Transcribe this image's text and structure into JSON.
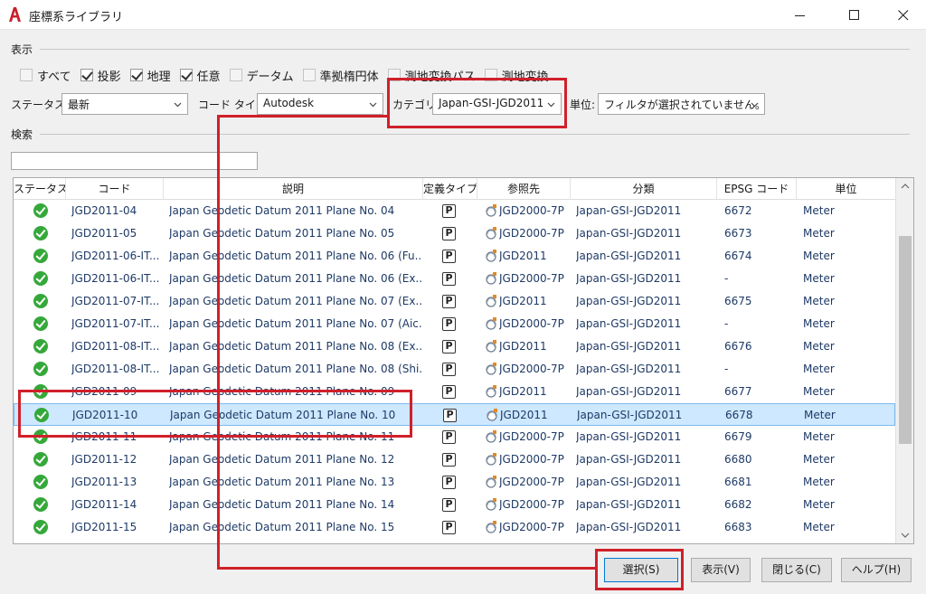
{
  "window": {
    "title": "座標系ライブラリ",
    "app_icon": "autocad-a-icon",
    "controls": [
      "minimize-icon",
      "maximize-icon",
      "close-icon"
    ]
  },
  "display_group": {
    "label": "表示",
    "checkboxes": [
      {
        "label": "すべて",
        "checked": false,
        "enabled": false
      },
      {
        "label": "投影",
        "checked": true,
        "enabled": true
      },
      {
        "label": "地理",
        "checked": true,
        "enabled": true
      },
      {
        "label": "任意",
        "checked": true,
        "enabled": true
      },
      {
        "label": "データム",
        "checked": false,
        "enabled": false
      },
      {
        "label": "準拠楕円体",
        "checked": false,
        "enabled": false
      },
      {
        "label": "測地変換パス",
        "checked": false,
        "enabled": false
      },
      {
        "label": "測地変換",
        "checked": false,
        "enabled": false
      }
    ]
  },
  "filters": {
    "status_label": "ステータス:",
    "status_value": "最新",
    "codetype_label": "コード タイプ:",
    "codetype_value": "Autodesk",
    "category_label": "カテゴリ:",
    "category_value": "Japan-GSI-JGD2011",
    "unit_label": "単位:",
    "unit_value": "フィルタが選択されていません。"
  },
  "search_group": {
    "label": "検索",
    "value": ""
  },
  "table": {
    "columns": [
      "ステータス",
      "コード",
      "説明",
      "定義タイプ",
      "参照先",
      "分類",
      "EPSG コード",
      "単位"
    ],
    "rows": [
      {
        "code": "JGD2011-04",
        "desc": "Japan Geodetic Datum 2011 Plane No. 04",
        "type": "P",
        "ref": "JGD2000-7P",
        "cls": "Japan-GSI-JGD2011",
        "epsg": "6672",
        "unit": "Meter"
      },
      {
        "code": "JGD2011-05",
        "desc": "Japan Geodetic Datum 2011 Plane No. 05",
        "type": "P",
        "ref": "JGD2000-7P",
        "cls": "Japan-GSI-JGD2011",
        "epsg": "6673",
        "unit": "Meter"
      },
      {
        "code": "JGD2011-06-IT...",
        "desc": "Japan Geodetic Datum 2011 Plane No. 06 (Fu...",
        "type": "P",
        "ref": "JGD2011",
        "cls": "Japan-GSI-JGD2011",
        "epsg": "6674",
        "unit": "Meter"
      },
      {
        "code": "JGD2011-06-IT...",
        "desc": "Japan Geodetic Datum 2011 Plane No. 06 (Ex...",
        "type": "P",
        "ref": "JGD2000-7P",
        "cls": "Japan-GSI-JGD2011",
        "epsg": "-",
        "unit": "Meter"
      },
      {
        "code": "JGD2011-07-IT...",
        "desc": "Japan Geodetic Datum 2011 Plane No. 07 (Ex...",
        "type": "P",
        "ref": "JGD2011",
        "cls": "Japan-GSI-JGD2011",
        "epsg": "6675",
        "unit": "Meter"
      },
      {
        "code": "JGD2011-07-IT...",
        "desc": "Japan Geodetic Datum 2011 Plane No. 07 (Aic...",
        "type": "P",
        "ref": "JGD2000-7P",
        "cls": "Japan-GSI-JGD2011",
        "epsg": "-",
        "unit": "Meter"
      },
      {
        "code": "JGD2011-08-IT...",
        "desc": "Japan Geodetic Datum 2011 Plane No. 08 (Ex...",
        "type": "P",
        "ref": "JGD2011",
        "cls": "Japan-GSI-JGD2011",
        "epsg": "6676",
        "unit": "Meter"
      },
      {
        "code": "JGD2011-08-IT...",
        "desc": "Japan Geodetic Datum 2011 Plane No. 08 (Shi...",
        "type": "P",
        "ref": "JGD2000-7P",
        "cls": "Japan-GSI-JGD2011",
        "epsg": "-",
        "unit": "Meter"
      },
      {
        "code": "JGD2011-09",
        "desc": "Japan Geodetic Datum 2011 Plane No. 09",
        "type": "P",
        "ref": "JGD2011",
        "cls": "Japan-GSI-JGD2011",
        "epsg": "6677",
        "unit": "Meter"
      },
      {
        "code": "JGD2011-10",
        "desc": "Japan Geodetic Datum 2011 Plane No. 10",
        "type": "P",
        "ref": "JGD2011",
        "cls": "Japan-GSI-JGD2011",
        "epsg": "6678",
        "unit": "Meter",
        "selected": true
      },
      {
        "code": "JGD2011-11",
        "desc": "Japan Geodetic Datum 2011 Plane No. 11",
        "type": "P",
        "ref": "JGD2000-7P",
        "cls": "Japan-GSI-JGD2011",
        "epsg": "6679",
        "unit": "Meter"
      },
      {
        "code": "JGD2011-12",
        "desc": "Japan Geodetic Datum 2011 Plane No. 12",
        "type": "P",
        "ref": "JGD2000-7P",
        "cls": "Japan-GSI-JGD2011",
        "epsg": "6680",
        "unit": "Meter"
      },
      {
        "code": "JGD2011-13",
        "desc": "Japan Geodetic Datum 2011 Plane No. 13",
        "type": "P",
        "ref": "JGD2000-7P",
        "cls": "Japan-GSI-JGD2011",
        "epsg": "6681",
        "unit": "Meter"
      },
      {
        "code": "JGD2011-14",
        "desc": "Japan Geodetic Datum 2011 Plane No. 14",
        "type": "P",
        "ref": "JGD2000-7P",
        "cls": "Japan-GSI-JGD2011",
        "epsg": "6682",
        "unit": "Meter"
      },
      {
        "code": "JGD2011-15",
        "desc": "Japan Geodetic Datum 2011 Plane No. 15",
        "type": "P",
        "ref": "JGD2000-7P",
        "cls": "Japan-GSI-JGD2011",
        "epsg": "6683",
        "unit": "Meter"
      }
    ]
  },
  "buttons": {
    "select": "選択(S)",
    "show": "表示(V)",
    "close": "閉じる(C)",
    "help": "ヘルプ(H)"
  },
  "colors": {
    "annotation_red": "#d0202a",
    "status_green": "#35a83a",
    "selection_blue": "#cde8ff"
  }
}
